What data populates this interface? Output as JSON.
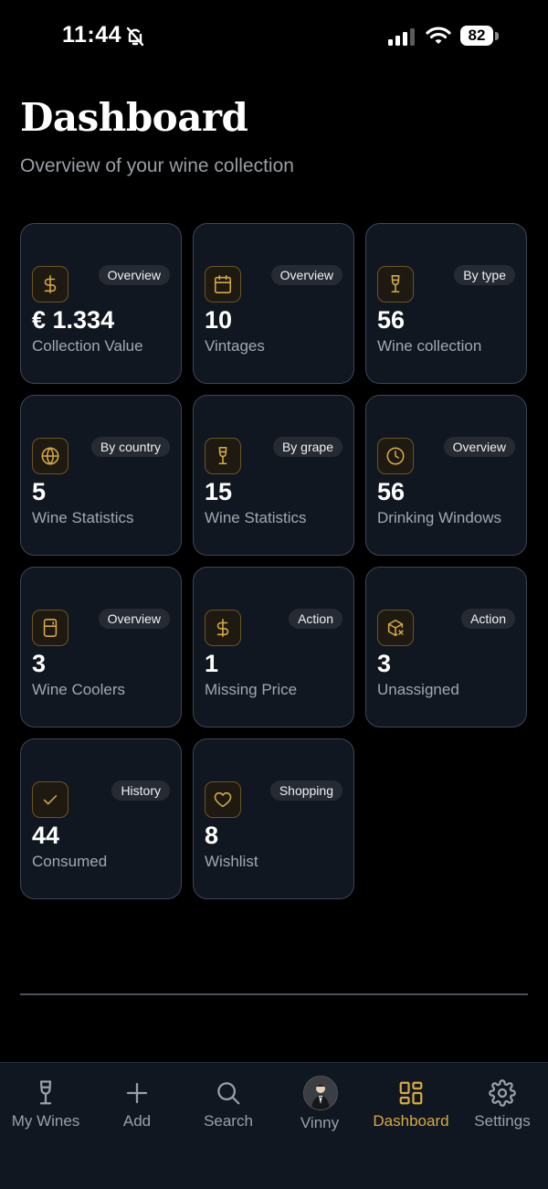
{
  "status_bar": {
    "time": "11:44",
    "battery": "82"
  },
  "header": {
    "title": "Dashboard",
    "subtitle": "Overview of your wine collection"
  },
  "cards": [
    {
      "icon": "dollar-icon",
      "badge": "Overview",
      "value": "€ 1.334",
      "label": "Collection Value"
    },
    {
      "icon": "calendar-icon",
      "badge": "Overview",
      "value": "10",
      "label": "Vintages"
    },
    {
      "icon": "wine-glass-icon",
      "badge": "By type",
      "value": "56",
      "label": "Wine collection"
    },
    {
      "icon": "globe-icon",
      "badge": "By country",
      "value": "5",
      "label": "Wine Statistics"
    },
    {
      "icon": "wine-glass-icon",
      "badge": "By grape",
      "value": "15",
      "label": "Wine Statistics"
    },
    {
      "icon": "clock-icon",
      "badge": "Overview",
      "value": "56",
      "label": "Drinking Windows"
    },
    {
      "icon": "fridge-icon",
      "badge": "Overview",
      "value": "3",
      "label": "Wine Coolers"
    },
    {
      "icon": "dollar-icon",
      "badge": "Action",
      "value": "1",
      "label": "Missing Price"
    },
    {
      "icon": "box-x-icon",
      "badge": "Action",
      "value": "3",
      "label": "Unassigned"
    },
    {
      "icon": "check-icon",
      "badge": "History",
      "value": "44",
      "label": "Consumed"
    },
    {
      "icon": "heart-icon",
      "badge": "Shopping",
      "value": "8",
      "label": "Wishlist"
    }
  ],
  "tabs": [
    {
      "label": "My Wines",
      "icon": "wine-glass-icon",
      "active": false
    },
    {
      "label": "Add",
      "icon": "plus-icon",
      "active": false
    },
    {
      "label": "Search",
      "icon": "search-icon",
      "active": false
    },
    {
      "label": "Vinny",
      "icon": "avatar",
      "active": false
    },
    {
      "label": "Dashboard",
      "icon": "dashboard-grid-icon",
      "active": true
    },
    {
      "label": "Settings",
      "icon": "gear-icon",
      "active": false
    }
  ],
  "colors": {
    "background": "#000000",
    "card_background": "#111721",
    "card_border": "#3e4655",
    "accent": "#d6a945",
    "muted_text": "#a3a7ae"
  }
}
